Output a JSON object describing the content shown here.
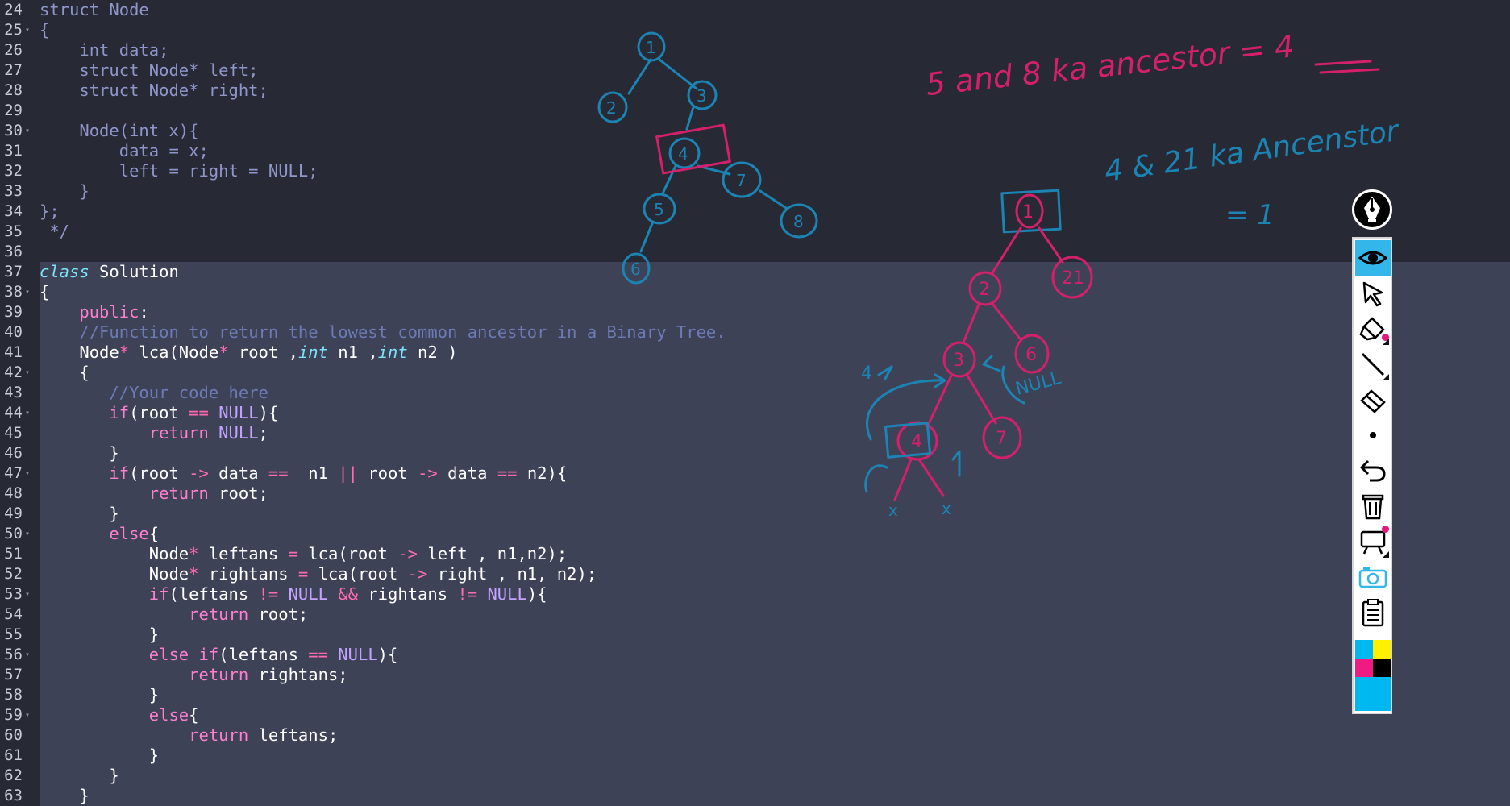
{
  "editor": {
    "lines": [
      {
        "n": "24",
        "fold": false,
        "hl": false,
        "tokens": [
          [
            "d",
            "struct Node"
          ]
        ]
      },
      {
        "n": "25",
        "fold": true,
        "hl": false,
        "tokens": [
          [
            "d",
            "{"
          ]
        ]
      },
      {
        "n": "26",
        "fold": false,
        "hl": false,
        "tokens": [
          [
            "d",
            "    int data;"
          ]
        ]
      },
      {
        "n": "27",
        "fold": false,
        "hl": false,
        "tokens": [
          [
            "d",
            "    struct Node* left;"
          ]
        ]
      },
      {
        "n": "28",
        "fold": false,
        "hl": false,
        "tokens": [
          [
            "d",
            "    struct Node* right;"
          ]
        ]
      },
      {
        "n": "29",
        "fold": false,
        "hl": false,
        "tokens": []
      },
      {
        "n": "30",
        "fold": true,
        "hl": false,
        "tokens": [
          [
            "d",
            "    Node(int x){"
          ]
        ]
      },
      {
        "n": "31",
        "fold": false,
        "hl": false,
        "tokens": [
          [
            "d",
            "        data = x;"
          ]
        ]
      },
      {
        "n": "32",
        "fold": false,
        "hl": false,
        "tokens": [
          [
            "d",
            "        left = right = NULL;"
          ]
        ]
      },
      {
        "n": "33",
        "fold": false,
        "hl": false,
        "tokens": [
          [
            "d",
            "    }"
          ]
        ]
      },
      {
        "n": "34",
        "fold": false,
        "hl": false,
        "tokens": [
          [
            "d",
            "};"
          ]
        ]
      },
      {
        "n": "35",
        "fold": false,
        "hl": false,
        "tokens": [
          [
            "d",
            " */"
          ]
        ]
      },
      {
        "n": "36",
        "fold": false,
        "hl": false,
        "tokens": []
      },
      {
        "n": "37",
        "fold": false,
        "hl": true,
        "tokens": [
          [
            "ty",
            "class"
          ],
          [
            "t",
            " Solution"
          ]
        ]
      },
      {
        "n": "38",
        "fold": true,
        "hl": true,
        "tokens": [
          [
            "t",
            "{"
          ]
        ]
      },
      {
        "n": "39",
        "fold": false,
        "hl": true,
        "tokens": [
          [
            "t",
            "    "
          ],
          [
            "kw",
            "public"
          ],
          [
            "t",
            ":"
          ]
        ]
      },
      {
        "n": "40",
        "fold": false,
        "hl": true,
        "tokens": [
          [
            "t",
            "    "
          ],
          [
            "cm",
            "//Function to return the lowest common ancestor in a Binary Tree."
          ]
        ]
      },
      {
        "n": "41",
        "fold": false,
        "hl": true,
        "tokens": [
          [
            "t",
            "    Node"
          ],
          [
            "op",
            "*"
          ],
          [
            "t",
            " lca(Node"
          ],
          [
            "op",
            "*"
          ],
          [
            "t",
            " root ,"
          ],
          [
            "ty",
            "int"
          ],
          [
            "t",
            " n1 ,"
          ],
          [
            "ty",
            "int"
          ],
          [
            "t",
            " n2 )"
          ]
        ]
      },
      {
        "n": "42",
        "fold": true,
        "hl": true,
        "tokens": [
          [
            "t",
            "    {"
          ]
        ]
      },
      {
        "n": "43",
        "fold": false,
        "hl": true,
        "tokens": [
          [
            "t",
            "       "
          ],
          [
            "cm",
            "//Your code here"
          ]
        ]
      },
      {
        "n": "44",
        "fold": true,
        "hl": true,
        "tokens": [
          [
            "t",
            "       "
          ],
          [
            "kw",
            "if"
          ],
          [
            "t",
            "(root "
          ],
          [
            "op",
            "=="
          ],
          [
            "t",
            " "
          ],
          [
            "nl",
            "NULL"
          ],
          [
            "t",
            "){"
          ]
        ]
      },
      {
        "n": "45",
        "fold": false,
        "hl": true,
        "tokens": [
          [
            "t",
            "           "
          ],
          [
            "kw",
            "return"
          ],
          [
            "t",
            " "
          ],
          [
            "nl",
            "NULL"
          ],
          [
            "t",
            ";"
          ]
        ]
      },
      {
        "n": "46",
        "fold": false,
        "hl": true,
        "tokens": [
          [
            "t",
            "       }"
          ]
        ]
      },
      {
        "n": "47",
        "fold": true,
        "hl": true,
        "tokens": [
          [
            "t",
            "       "
          ],
          [
            "kw",
            "if"
          ],
          [
            "t",
            "(root "
          ],
          [
            "op",
            "->"
          ],
          [
            "t",
            " data "
          ],
          [
            "op",
            "=="
          ],
          [
            "t",
            "  n1 "
          ],
          [
            "op",
            "||"
          ],
          [
            "t",
            " root "
          ],
          [
            "op",
            "->"
          ],
          [
            "t",
            " data "
          ],
          [
            "op",
            "=="
          ],
          [
            "t",
            " n2){"
          ]
        ]
      },
      {
        "n": "48",
        "fold": false,
        "hl": true,
        "tokens": [
          [
            "t",
            "           "
          ],
          [
            "kw",
            "return"
          ],
          [
            "t",
            " root;"
          ]
        ]
      },
      {
        "n": "49",
        "fold": false,
        "hl": true,
        "tokens": [
          [
            "t",
            "       }"
          ]
        ]
      },
      {
        "n": "50",
        "fold": true,
        "hl": true,
        "tokens": [
          [
            "t",
            "       "
          ],
          [
            "kw",
            "else"
          ],
          [
            "t",
            "{"
          ]
        ]
      },
      {
        "n": "51",
        "fold": false,
        "hl": true,
        "tokens": [
          [
            "t",
            "           Node"
          ],
          [
            "op",
            "*"
          ],
          [
            "t",
            " leftans "
          ],
          [
            "op",
            "="
          ],
          [
            "t",
            " lca(root "
          ],
          [
            "op",
            "->"
          ],
          [
            "t",
            " left , n1,n2);"
          ]
        ]
      },
      {
        "n": "52",
        "fold": false,
        "hl": true,
        "tokens": [
          [
            "t",
            "           Node"
          ],
          [
            "op",
            "*"
          ],
          [
            "t",
            " rightans "
          ],
          [
            "op",
            "="
          ],
          [
            "t",
            " lca(root "
          ],
          [
            "op",
            "->"
          ],
          [
            "t",
            " right , n1, n2);"
          ]
        ]
      },
      {
        "n": "53",
        "fold": true,
        "hl": true,
        "tokens": [
          [
            "t",
            "           "
          ],
          [
            "kw",
            "if"
          ],
          [
            "t",
            "(leftans "
          ],
          [
            "op",
            "!="
          ],
          [
            "t",
            " "
          ],
          [
            "nl",
            "NULL"
          ],
          [
            "t",
            " "
          ],
          [
            "op",
            "&&"
          ],
          [
            "t",
            " rightans "
          ],
          [
            "op",
            "!="
          ],
          [
            "t",
            " "
          ],
          [
            "nl",
            "NULL"
          ],
          [
            "t",
            "){"
          ]
        ]
      },
      {
        "n": "54",
        "fold": false,
        "hl": true,
        "tokens": [
          [
            "t",
            "               "
          ],
          [
            "kw",
            "return"
          ],
          [
            "t",
            " root;"
          ]
        ]
      },
      {
        "n": "55",
        "fold": false,
        "hl": true,
        "tokens": [
          [
            "t",
            "           }"
          ]
        ]
      },
      {
        "n": "56",
        "fold": true,
        "hl": true,
        "tokens": [
          [
            "t",
            "           "
          ],
          [
            "kw",
            "else if"
          ],
          [
            "t",
            "(leftans "
          ],
          [
            "op",
            "=="
          ],
          [
            "t",
            " "
          ],
          [
            "nl",
            "NULL"
          ],
          [
            "t",
            "){"
          ]
        ]
      },
      {
        "n": "57",
        "fold": false,
        "hl": true,
        "tokens": [
          [
            "t",
            "               "
          ],
          [
            "kw",
            "return"
          ],
          [
            "t",
            " rightans;"
          ]
        ]
      },
      {
        "n": "58",
        "fold": false,
        "hl": true,
        "tokens": [
          [
            "t",
            "           }"
          ]
        ]
      },
      {
        "n": "59",
        "fold": true,
        "hl": true,
        "tokens": [
          [
            "t",
            "           "
          ],
          [
            "kw",
            "else"
          ],
          [
            "t",
            "{"
          ]
        ]
      },
      {
        "n": "60",
        "fold": false,
        "hl": true,
        "tokens": [
          [
            "t",
            "               "
          ],
          [
            "kw",
            "return"
          ],
          [
            "t",
            " leftans;"
          ]
        ]
      },
      {
        "n": "61",
        "fold": false,
        "hl": true,
        "tokens": [
          [
            "t",
            "           }"
          ]
        ]
      },
      {
        "n": "62",
        "fold": false,
        "hl": true,
        "tokens": [
          [
            "t",
            "       }"
          ]
        ]
      },
      {
        "n": "63",
        "fold": false,
        "hl": true,
        "tokens": [
          [
            "t",
            "    }"
          ]
        ]
      }
    ]
  },
  "annotations": {
    "tree1": {
      "nodes": [
        "1",
        "2",
        "3",
        "4",
        "7",
        "5",
        "8",
        "6"
      ]
    },
    "tree2": {
      "nodes": [
        "1",
        "21",
        "2",
        "6",
        "3",
        "4",
        "7"
      ],
      "side_labels": [
        "4",
        "NULL",
        "x",
        "x"
      ]
    },
    "note1": "5 and 8 ka ancestor = 4",
    "note2": "4 & 21 ka Ancenstor",
    "note2_value": "= 1",
    "ink_colors": {
      "blue": "#1b84b3",
      "pink": "#d4206b"
    }
  },
  "toolbar": {
    "tools": [
      "eye-icon",
      "pointer-icon",
      "highlighter-icon",
      "line-icon",
      "eraser-icon",
      "dot-icon",
      "undo-icon",
      "trash-icon",
      "whiteboard-icon",
      "camera-icon",
      "clipboard-icon"
    ],
    "active": "eye-icon",
    "palette": [
      "#00b8f0",
      "#fff000",
      "#ef1a82",
      "#000000",
      "#00b8f0"
    ]
  }
}
